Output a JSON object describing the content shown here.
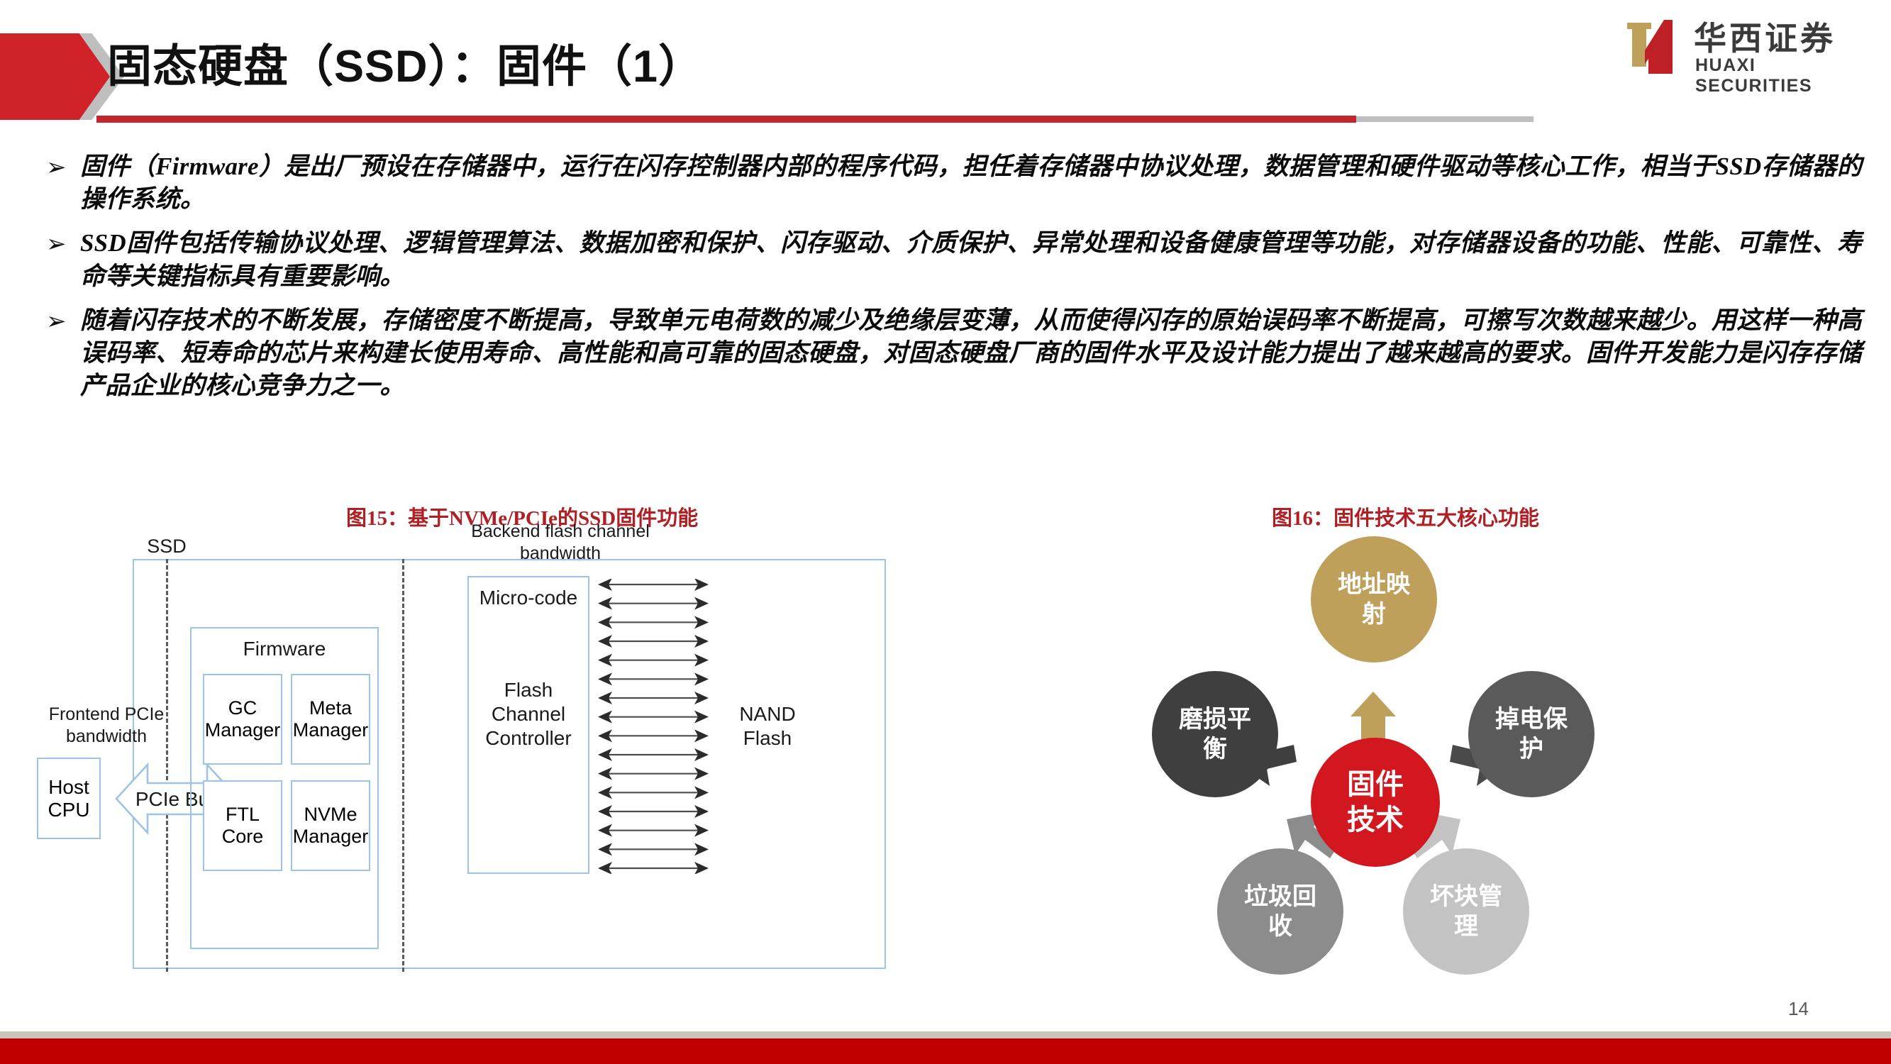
{
  "header": {
    "title": "固态硬盘（SSD）：固件（1）",
    "accent_red": "#c0272d",
    "accent_gray": "#bfbfbf"
  },
  "logo": {
    "cn": "华西证券",
    "en": "HUAXI SECURITIES",
    "mark_gold": "#bfa05a",
    "mark_red": "#bf2026"
  },
  "bullets": [
    {
      "marker": "➢",
      "text": "固件（Firmware）是出厂预设在存储器中，运行在闪存控制器内部的程序代码，担任着存储器中协议处理，数据管理和硬件驱动等核心工作，相当于SSD存储器的操作系统。"
    },
    {
      "marker": "➢",
      "text": "SSD固件包括传输协议处理、逻辑管理算法、数据加密和保护、闪存驱动、介质保护、异常处理和设备健康管理等功能，对存储器设备的功能、性能、可靠性、寿命等关键指标具有重要影响。"
    },
    {
      "marker": "➢",
      "text": "随着闪存技术的不断发展，存储密度不断提高，导致单元电荷数的减少及绝缘层变薄，从而使得闪存的原始误码率不断提高，可擦写次数越来越少。用这样一种高误码率、短寿命的芯片来构建长使用寿命、高性能和高可靠的固态硬盘，对固态硬盘厂商的固件水平及设计能力提出了越来越高的要求。固件开发能力是闪存存储产品企业的核心竞争力之一。"
    }
  ],
  "figures": {
    "left": {
      "caption": "图15：基于NVMe/PCIe的SSD固件功能",
      "labels": {
        "ssd": "SSD",
        "frontend": "Frontend PCIe\nbandwidth",
        "host_cpu": "Host\nCPU",
        "pcie_bus": "PCIe Bus",
        "firmware": "Firmware",
        "gc_manager": "GC\nManager",
        "meta_manager": "Meta\nManager",
        "ftl_core": "FTL Core",
        "nvme_manager": "NVMe\nManager",
        "backend": "Backend flash channel\nbandwidth",
        "micro_code": "Micro-code",
        "flash_channel_controller": "Flash\nChannel\nController",
        "nand_flash": "NAND\nFlash"
      },
      "channel_arrow_count": 16,
      "box_border_color": "#9dc3e6"
    },
    "right": {
      "caption": "图16：固件技术五大核心功能",
      "center": {
        "label": "固件\n技术",
        "color": "#d3171e"
      },
      "nodes": [
        {
          "label": "地址映\n射",
          "color": "#bfa05a",
          "position": "top"
        },
        {
          "label": "掉电保\n护",
          "color": "#5a5a5a",
          "position": "right"
        },
        {
          "label": "坏块管\n理",
          "color": "#c3c3c3",
          "position": "bottom-right"
        },
        {
          "label": "垃圾回\n收",
          "color": "#8c8c8c",
          "position": "bottom-left"
        },
        {
          "label": "磨损平\n衡",
          "color": "#3f3f3f",
          "position": "left"
        }
      ],
      "arrows": [
        {
          "to": "top",
          "color": "#bfa05a"
        },
        {
          "to": "right",
          "color": "#4a4a4a"
        },
        {
          "to": "bottom-right",
          "color": "#c3c3c3"
        },
        {
          "to": "bottom-left",
          "color": "#8c8c8c"
        },
        {
          "to": "left",
          "color": "#3f3f3f"
        }
      ]
    }
  },
  "footer": {
    "page_number": "14",
    "bar_red": "#c00000",
    "bar_gray": "#c9c5bd"
  }
}
